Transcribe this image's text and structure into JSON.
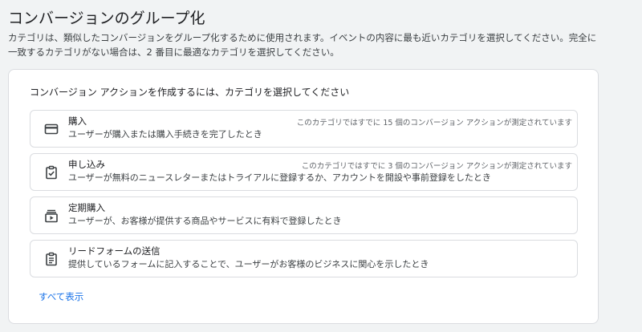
{
  "page": {
    "title": "コンバージョンのグループ化",
    "description": "カテゴリは、類似したコンバージョンをグループ化するために使用されます。イベントの内容に最も近いカテゴリを選択してください。完全に一致するカテゴリがない場合は、2 番目に最適なカテゴリを選択してください。"
  },
  "card": {
    "heading": "コンバージョン アクションを作成するには、カテゴリを選択してください",
    "options": [
      {
        "title": "購入",
        "description": "ユーザーが購入または購入手続きを完了したとき",
        "status": "このカテゴリではすでに 15 個のコンバージョン アクションが測定されています",
        "icon": "credit-card-icon"
      },
      {
        "title": "申し込み",
        "description": "ユーザーが無料のニュースレターまたはトライアルに登録するか、アカウントを開設や事前登録をしたとき",
        "status": "このカテゴリではすでに 3 個のコンバージョン アクションが測定されています",
        "icon": "clipboard-check-icon"
      },
      {
        "title": "定期購入",
        "description": "ユーザーが、お客様が提供する商品やサービスに有料で登録したとき",
        "icon": "subscriptions-icon"
      },
      {
        "title": "リードフォームの送信",
        "description": "提供しているフォームに記入することで、ユーザーがお客様のビジネスに関心を示したとき",
        "icon": "form-clipboard-icon"
      }
    ],
    "show_all": "すべて表示"
  },
  "colors": {
    "accent": "#1a73e8",
    "border": "#dadce0",
    "background": "#f1f3f4"
  }
}
